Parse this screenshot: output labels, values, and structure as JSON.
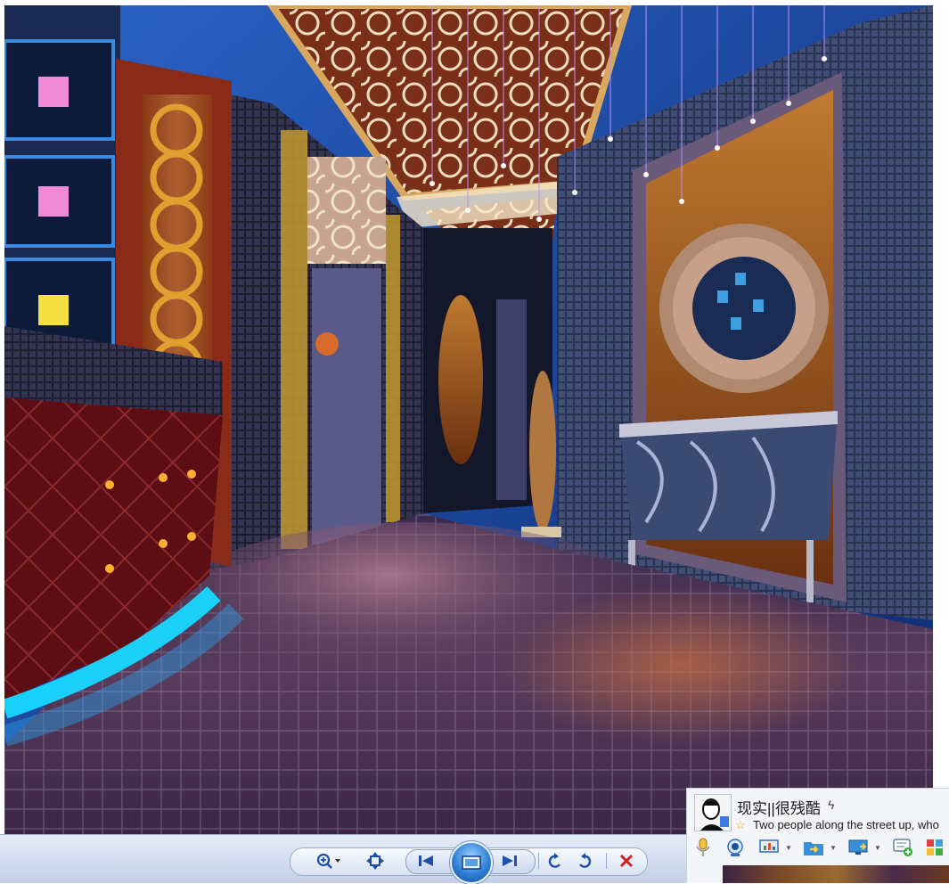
{
  "viewer": {
    "toolbar": {
      "buttons": [
        {
          "name": "zoom",
          "icon": "magnifier-zoom-icon"
        },
        {
          "name": "actual-size",
          "icon": "fit-window-icon"
        },
        {
          "name": "previous",
          "icon": "previous-icon"
        },
        {
          "name": "slideshow",
          "icon": "slideshow-icon"
        },
        {
          "name": "next",
          "icon": "next-icon"
        },
        {
          "name": "rotate-left",
          "icon": "rotate-ccw-icon"
        },
        {
          "name": "rotate-right",
          "icon": "rotate-cw-icon"
        },
        {
          "name": "delete",
          "icon": "delete-x-icon"
        }
      ]
    }
  },
  "popup": {
    "name": "现实||很残酷",
    "name_symbol": "ϟ",
    "status_star": "☆",
    "signature": "Two people along the street up, who",
    "icons": [
      "microphone-icon",
      "webcam-icon",
      "presentation-icon",
      "folder-transfer-icon",
      "remote-desktop-icon",
      "add-message-icon",
      "apps-grid-icon"
    ]
  },
  "colors": {
    "toolbar_blue": "#1f4fa8",
    "delete_red": "#d02020",
    "neon_cyan": "#18d8ff",
    "floor_purple": "#5a3a5e"
  }
}
